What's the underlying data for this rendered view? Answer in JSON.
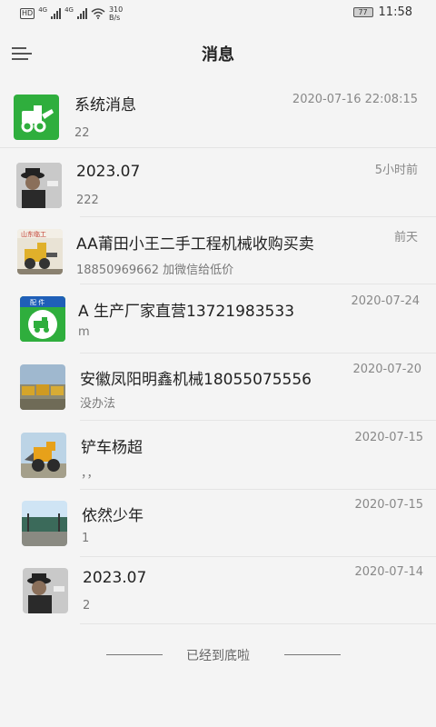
{
  "status_bar": {
    "hd_label": "HD",
    "net1": "4G",
    "net2": "4G",
    "speed_value": "310",
    "speed_unit": "B/s",
    "battery": "77",
    "time": "11:58"
  },
  "header": {
    "title": "消息"
  },
  "conversations": [
    {
      "name": "系统消息",
      "preview": "22",
      "time": "2020-07-16 22:08:15",
      "avatar": "system-logo"
    },
    {
      "name": "2023.07",
      "preview": "222",
      "time": "5小时前",
      "avatar": "person-photo"
    },
    {
      "name": "AA莆田小王二手工程机械收购买卖",
      "preview": "18850969662 加微信给低价",
      "time": "前天",
      "avatar": "loader-photo"
    },
    {
      "name": "A 生产厂家直营13721983533",
      "preview": "m",
      "time": "2020-07-24",
      "avatar": "brand-logo"
    },
    {
      "name": "安徽凤阳明鑫机械18055075556",
      "preview": "没办法",
      "time": "2020-07-20",
      "avatar": "machinery-yard-photo"
    },
    {
      "name": "铲车杨超",
      "preview": "，，",
      "time": "2020-07-15",
      "avatar": "yellow-loader-photo"
    },
    {
      "name": "依然少年",
      "preview": "1",
      "time": "2020-07-15",
      "avatar": "landscape-photo"
    },
    {
      "name": "2023.07",
      "preview": "2",
      "time": "2020-07-14",
      "avatar": "person-photo"
    }
  ],
  "footer": {
    "end_text": "已经到底啦"
  },
  "colors": {
    "brand_green": "#2fae3d",
    "background": "#f4f4f4",
    "separator": "#e4e4e4"
  }
}
